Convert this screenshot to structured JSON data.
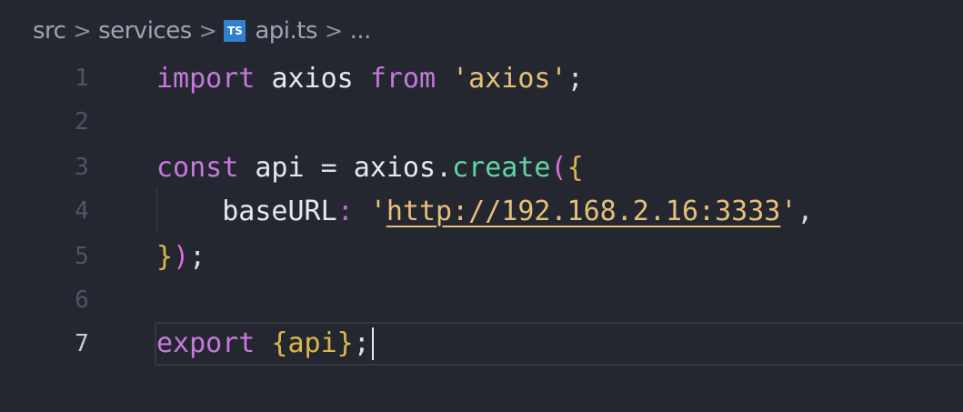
{
  "breadcrumb": {
    "items": [
      "src",
      "services",
      "api.ts",
      "..."
    ],
    "separator": ">",
    "file_icon_label": "TS"
  },
  "editor": {
    "lines": [
      {
        "number": "1",
        "text": "import axios from 'axios';"
      },
      {
        "number": "2",
        "text": ""
      },
      {
        "number": "3",
        "text": "const api = axios.create({"
      },
      {
        "number": "4",
        "text": "    baseURL: 'http://192.168.2.16:3333',"
      },
      {
        "number": "5",
        "text": "});"
      },
      {
        "number": "6",
        "text": ""
      },
      {
        "number": "7",
        "text": "export {api};"
      }
    ],
    "active_line": "7",
    "tokens": {
      "import": "import",
      "axios": "axios",
      "from": "from",
      "axios_str": "'axios'",
      "semi": ";",
      "const": "const",
      "api": "api",
      "eq": "=",
      "dot": ".",
      "create": "create",
      "open_paren": "(",
      "open_brace": "{",
      "baseURL": "baseURL",
      "colon": ":",
      "quote": "'",
      "url": "http://192.168.2.16:3333",
      "comma": ",",
      "close_brace": "}",
      "close_paren": ")",
      "export": "export",
      "export_body": "{api}"
    }
  },
  "colors": {
    "background": "#242730",
    "keyword": "#c678dd",
    "string": "#e5c07b",
    "function": "#61d6a4",
    "line_number": "#4d5566",
    "active_line_number": "#c7ccd8"
  }
}
